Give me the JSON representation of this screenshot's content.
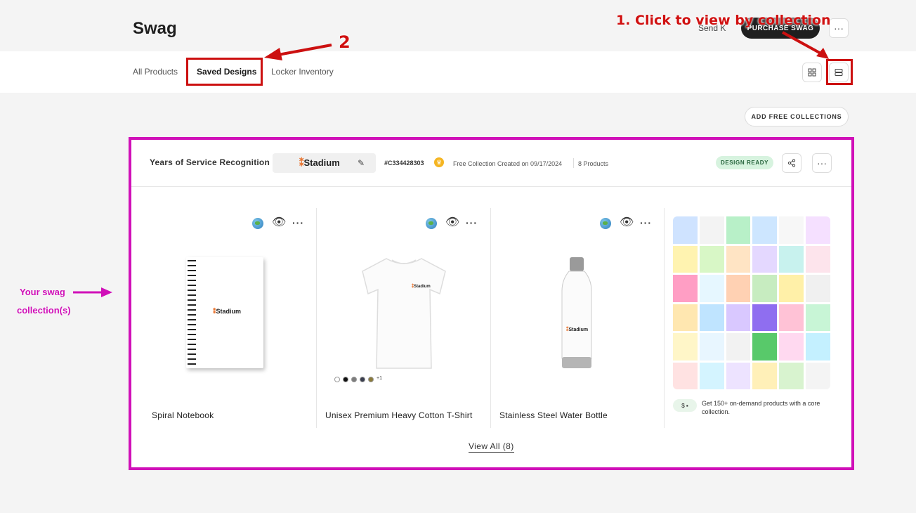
{
  "header": {
    "title": "Swag",
    "send_label": "Send K",
    "purchase_label": "PURCHASE SWAG",
    "more_label": "···"
  },
  "tabs": [
    {
      "label": "All Products"
    },
    {
      "label": "Saved Designs"
    },
    {
      "label": "Locker Inventory"
    }
  ],
  "toolbar": {
    "add_collections_label": "ADD FREE COLLECTIONS"
  },
  "collection": {
    "title": "Years of Service Recognition",
    "brand": "Stadium",
    "code": "#C334428303",
    "created": "Free Collection Created on 09/17/2024",
    "product_count": "8 Products",
    "status": "DESIGN READY",
    "view_all": "View All (8)",
    "products": [
      {
        "name": "Spiral Notebook",
        "logo": "Stadium"
      },
      {
        "name": "Unisex Premium Heavy Cotton T-Shirt",
        "logo": "Stadium",
        "more_colors": "+1"
      },
      {
        "name": "Stainless Steel Water Bottle",
        "logo": "Stadium"
      }
    ],
    "swatch_colors": [
      "#ffffff",
      "#111111",
      "#7d7d7d",
      "#3b3f4f",
      "#8a7a3a"
    ],
    "promo": {
      "price_label": "$",
      "text": "Get 150+ on-demand products with a core collection."
    }
  },
  "annotations": {
    "step1": "1. Click to view by collection",
    "step2": "2",
    "swag_line1": "Your swag",
    "swag_line2": "collection(s)"
  },
  "colors": {
    "annotation_red": "#cc1010",
    "annotation_magenta": "#d010b8",
    "status_bg": "#d7f3df"
  }
}
